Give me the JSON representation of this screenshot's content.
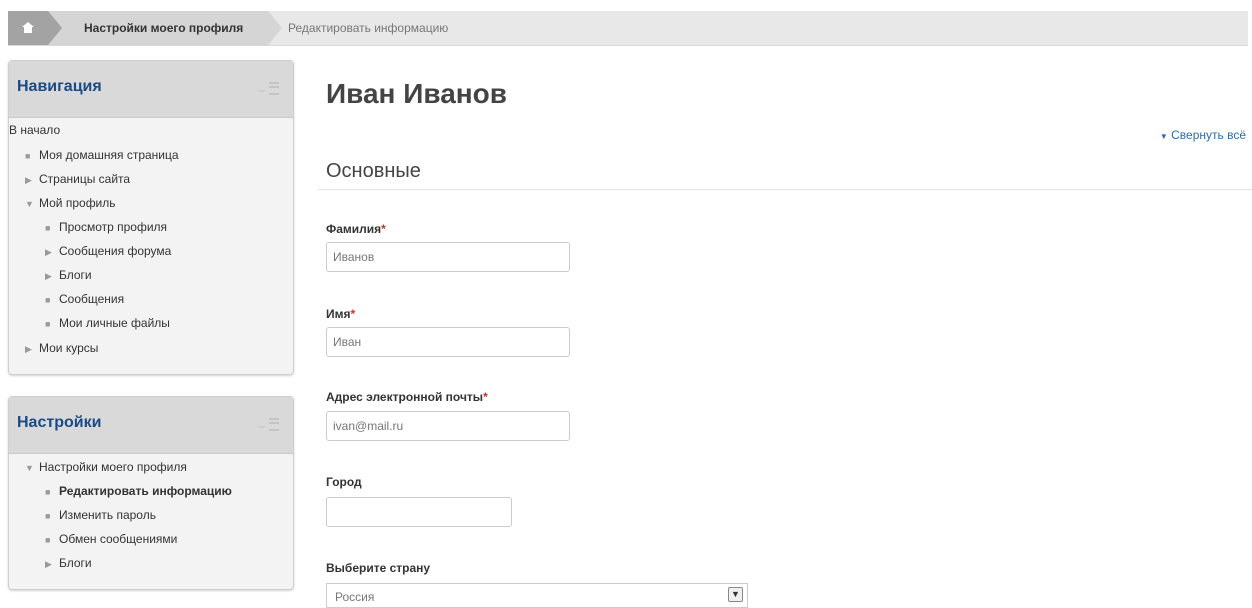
{
  "breadcrumb": {
    "home_icon": "home-icon",
    "items": [
      "Настройки моего профиля",
      "Редактировать информацию"
    ]
  },
  "navigation": {
    "title": "Навигация",
    "items": [
      {
        "label": "В начало",
        "icon": "none"
      },
      {
        "label": "Моя домашняя страница",
        "icon": "bullet"
      },
      {
        "label": "Страницы сайта",
        "icon": "triangle-right"
      },
      {
        "label": "Мой профиль",
        "icon": "triangle-down"
      },
      {
        "label": "Просмотр профиля",
        "icon": "bullet"
      },
      {
        "label": "Сообщения форума",
        "icon": "triangle-right"
      },
      {
        "label": "Блоги",
        "icon": "triangle-right"
      },
      {
        "label": "Сообщения",
        "icon": "bullet"
      },
      {
        "label": "Мои личные файлы",
        "icon": "bullet"
      },
      {
        "label": "Мои курсы",
        "icon": "triangle-right"
      }
    ]
  },
  "settings": {
    "title": "Настройки",
    "items": [
      {
        "label": "Настройки моего профиля",
        "icon": "triangle-down"
      },
      {
        "label": "Редактировать информацию",
        "icon": "bullet"
      },
      {
        "label": "Изменить пароль",
        "icon": "bullet"
      },
      {
        "label": "Обмен сообщениями",
        "icon": "bullet"
      },
      {
        "label": "Блоги",
        "icon": "triangle-right"
      }
    ]
  },
  "main": {
    "page_title": "Иван Иванов",
    "collapse_all": "Свернуть всё",
    "section_title": "Основные",
    "fields": {
      "lastname": {
        "label": "Фамилия",
        "required": "*",
        "value": "Иванов"
      },
      "firstname": {
        "label": "Имя",
        "required": "*",
        "value": "Иван"
      },
      "email": {
        "label": "Адрес электронной почты",
        "required": "*",
        "value": "ivan@mail.ru"
      },
      "city": {
        "label": "Город",
        "value": ""
      },
      "country": {
        "label": "Выберите страну",
        "value": "Россия"
      }
    }
  },
  "colors": {
    "accent": "#1a4b84",
    "link": "#2a6cb0",
    "required": "#c9302c"
  }
}
